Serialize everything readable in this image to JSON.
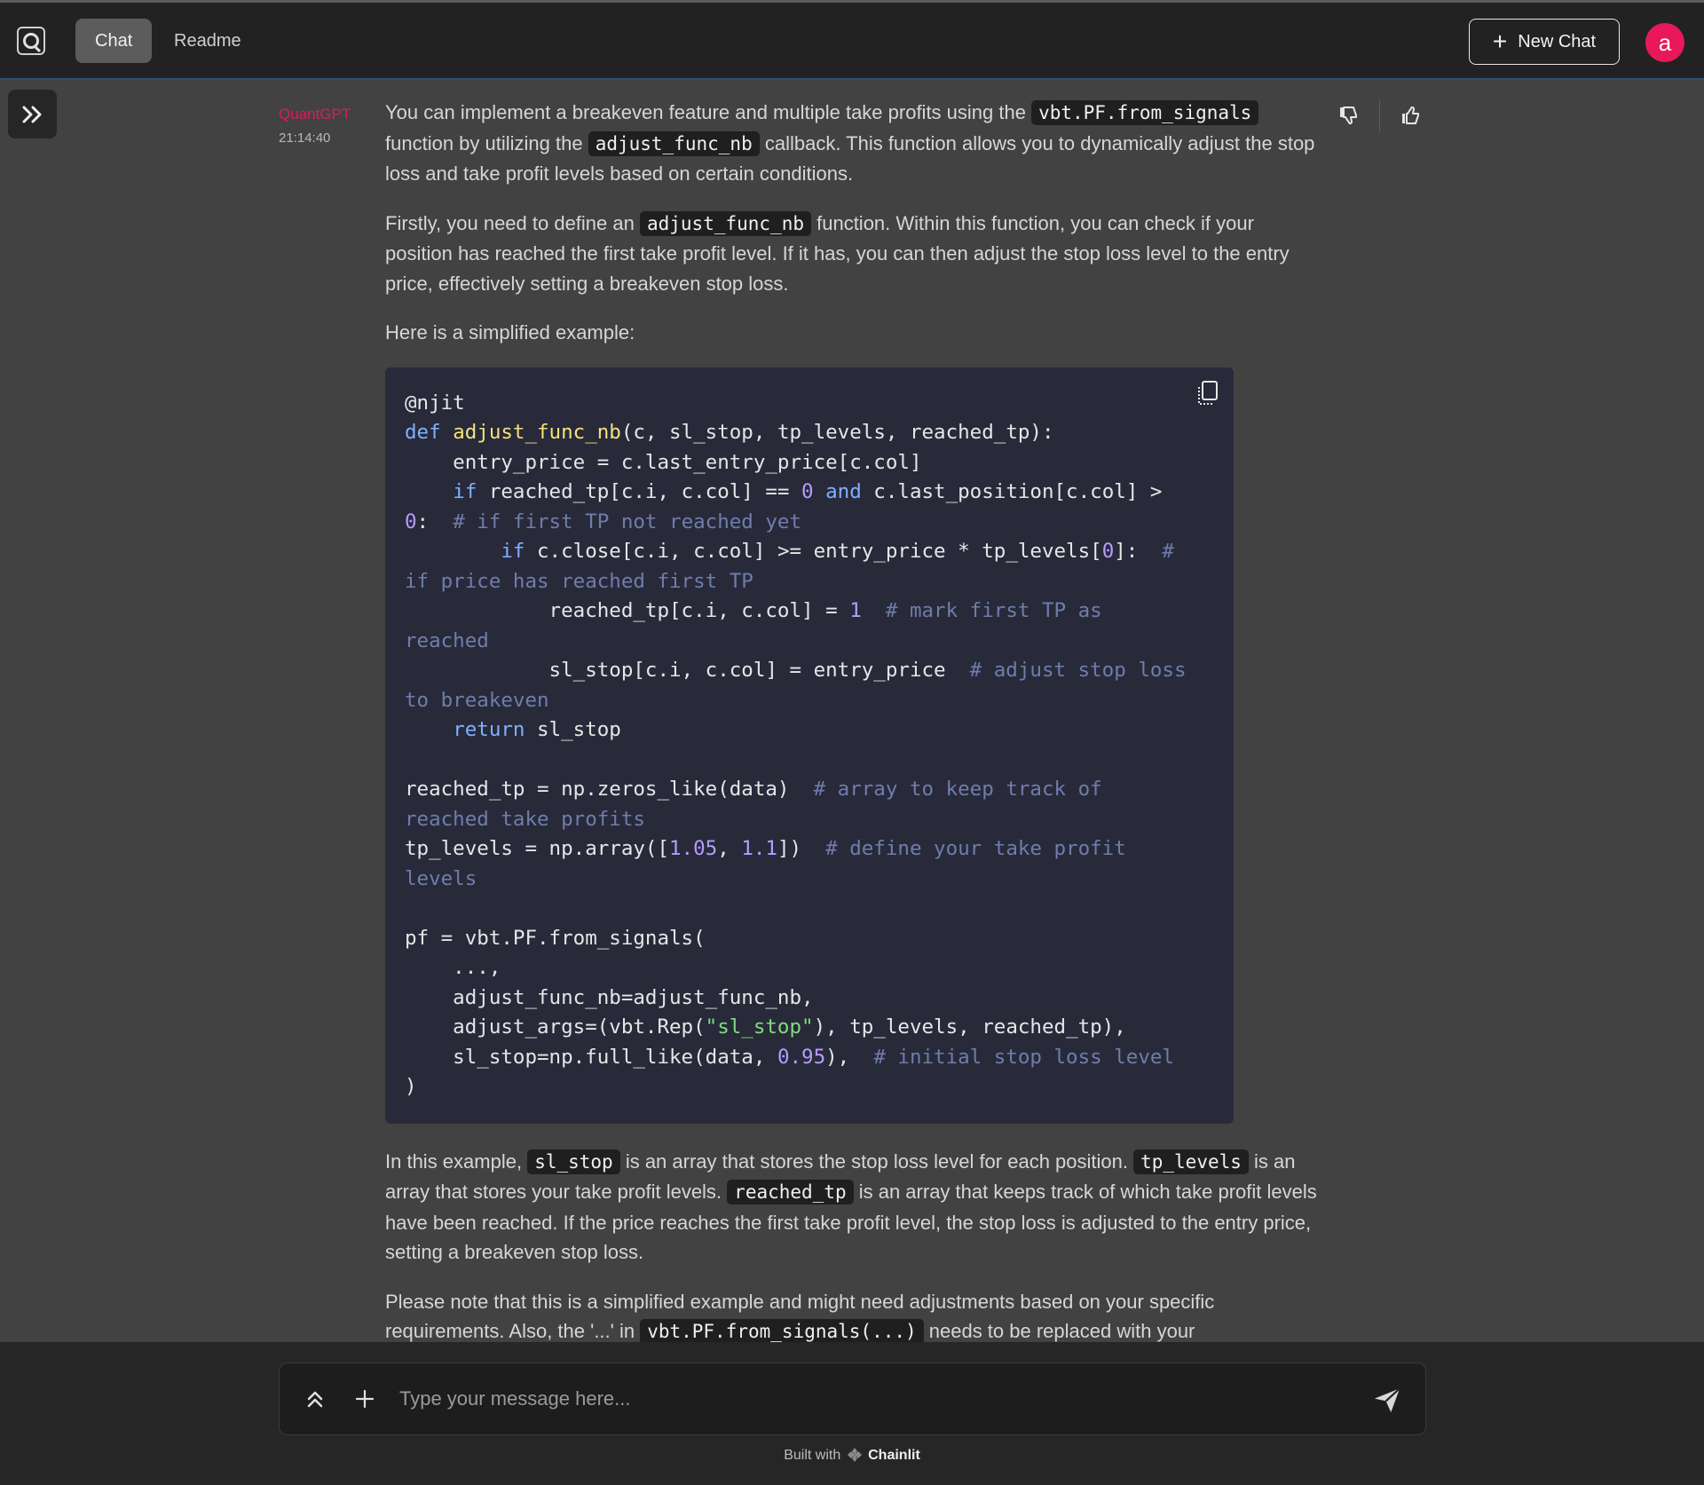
{
  "header": {
    "tabs": [
      {
        "label": "Chat",
        "active": true
      },
      {
        "label": "Readme",
        "active": false
      }
    ],
    "new_chat_label": "New Chat",
    "user_initial": "a"
  },
  "message": {
    "author": "QuantGPT",
    "time": "21:14:40",
    "p1": {
      "t1": "You can implement a breakeven feature and multiple take profits using the ",
      "c1": "vbt.PF.from_signals",
      "t2": " function by utilizing the ",
      "c2": "adjust_func_nb",
      "t3": " callback. This function allows you to dynamically adjust the stop loss and take profit levels based on certain conditions."
    },
    "p2": {
      "t1": "Firstly, you need to define an ",
      "c1": "adjust_func_nb",
      "t2": " function. Within this function, you can check if your position has reached the first take profit level. If it has, you can then adjust the stop loss level to the entry price, effectively setting a breakeven stop loss."
    },
    "p3": "Here is a simplified example:",
    "p4": {
      "t1": "In this example, ",
      "c1": "sl_stop",
      "t2": " is an array that stores the stop loss level for each position. ",
      "c2": "tp_levels",
      "t3": " is an array that stores your take profit levels. ",
      "c3": "reached_tp",
      "t4": " is an array that keeps track of which take profit levels have been reached. If the price reaches the first take profit level, the stop loss is adjusted to the entry price, setting a breakeven stop loss."
    },
    "p5": {
      "t1": "Please note that this is a simplified example and might need adjustments based on your specific requirements. Also, the '...' in ",
      "c1": "vbt.PF.from_signals(...)",
      "t2": " needs to be replaced with your"
    }
  },
  "composer": {
    "placeholder": "Type your message here..."
  },
  "footer": {
    "built_with": "Built with",
    "brand": "Chainlit"
  },
  "colors": {
    "accent": "#e8185a",
    "code_bg": "#282a3a"
  }
}
